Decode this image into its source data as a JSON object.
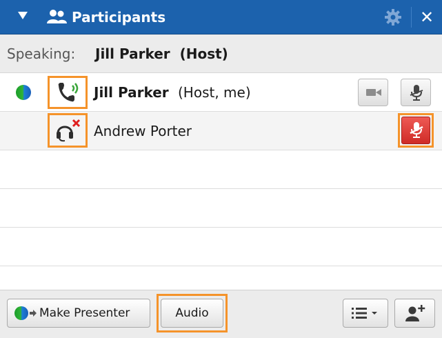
{
  "panel": {
    "title": "Participants",
    "accent_color": "#1c62ad",
    "highlight_color": "#f5932a"
  },
  "speaking": {
    "label": "Speaking:",
    "name": "Jill Parker  (Host)"
  },
  "participants": [
    {
      "name": "Jill Parker",
      "role": "(Host, me)",
      "status_icon": "globe-icon",
      "audio_icon": "phone-speaking-icon",
      "actions": [
        "video-camera-icon",
        "microphone-muted-icon"
      ]
    },
    {
      "name": "Andrew Porter",
      "role": "",
      "audio_icon": "headset-disconnected-icon",
      "actions": [
        "microphone-muted-red-icon"
      ]
    }
  ],
  "footer": {
    "make_presenter_label": "Make Presenter",
    "audio_label": "Audio",
    "list_options_icon": "list-menu-icon",
    "invite_icon": "add-user-icon"
  }
}
